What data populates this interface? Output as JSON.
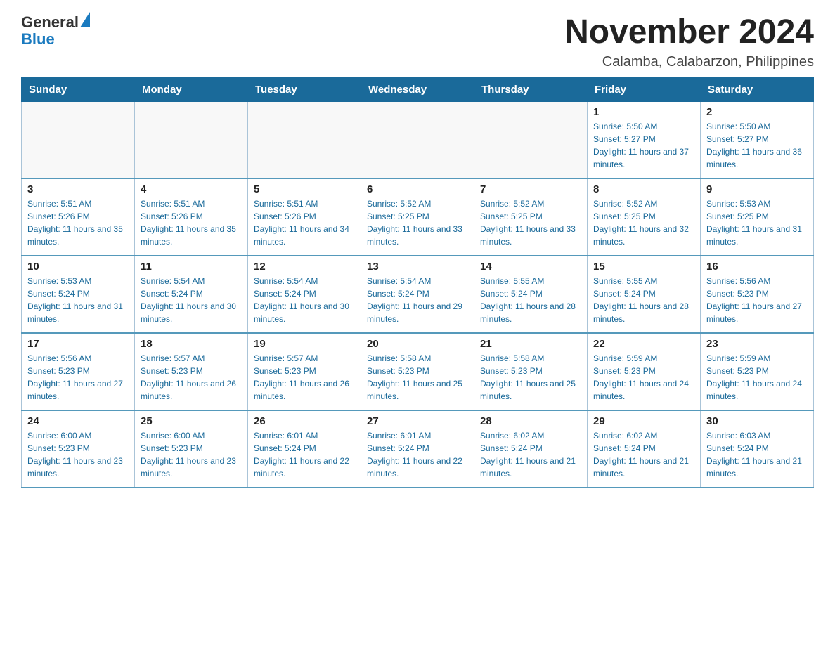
{
  "header": {
    "logo_general": "General",
    "logo_blue": "Blue",
    "month_title": "November 2024",
    "location": "Calamba, Calabarzon, Philippines"
  },
  "weekdays": [
    "Sunday",
    "Monday",
    "Tuesday",
    "Wednesday",
    "Thursday",
    "Friday",
    "Saturday"
  ],
  "weeks": [
    [
      {
        "day": "",
        "info": ""
      },
      {
        "day": "",
        "info": ""
      },
      {
        "day": "",
        "info": ""
      },
      {
        "day": "",
        "info": ""
      },
      {
        "day": "",
        "info": ""
      },
      {
        "day": "1",
        "sunrise": "Sunrise: 5:50 AM",
        "sunset": "Sunset: 5:27 PM",
        "daylight": "Daylight: 11 hours and 37 minutes."
      },
      {
        "day": "2",
        "sunrise": "Sunrise: 5:50 AM",
        "sunset": "Sunset: 5:27 PM",
        "daylight": "Daylight: 11 hours and 36 minutes."
      }
    ],
    [
      {
        "day": "3",
        "sunrise": "Sunrise: 5:51 AM",
        "sunset": "Sunset: 5:26 PM",
        "daylight": "Daylight: 11 hours and 35 minutes."
      },
      {
        "day": "4",
        "sunrise": "Sunrise: 5:51 AM",
        "sunset": "Sunset: 5:26 PM",
        "daylight": "Daylight: 11 hours and 35 minutes."
      },
      {
        "day": "5",
        "sunrise": "Sunrise: 5:51 AM",
        "sunset": "Sunset: 5:26 PM",
        "daylight": "Daylight: 11 hours and 34 minutes."
      },
      {
        "day": "6",
        "sunrise": "Sunrise: 5:52 AM",
        "sunset": "Sunset: 5:25 PM",
        "daylight": "Daylight: 11 hours and 33 minutes."
      },
      {
        "day": "7",
        "sunrise": "Sunrise: 5:52 AM",
        "sunset": "Sunset: 5:25 PM",
        "daylight": "Daylight: 11 hours and 33 minutes."
      },
      {
        "day": "8",
        "sunrise": "Sunrise: 5:52 AM",
        "sunset": "Sunset: 5:25 PM",
        "daylight": "Daylight: 11 hours and 32 minutes."
      },
      {
        "day": "9",
        "sunrise": "Sunrise: 5:53 AM",
        "sunset": "Sunset: 5:25 PM",
        "daylight": "Daylight: 11 hours and 31 minutes."
      }
    ],
    [
      {
        "day": "10",
        "sunrise": "Sunrise: 5:53 AM",
        "sunset": "Sunset: 5:24 PM",
        "daylight": "Daylight: 11 hours and 31 minutes."
      },
      {
        "day": "11",
        "sunrise": "Sunrise: 5:54 AM",
        "sunset": "Sunset: 5:24 PM",
        "daylight": "Daylight: 11 hours and 30 minutes."
      },
      {
        "day": "12",
        "sunrise": "Sunrise: 5:54 AM",
        "sunset": "Sunset: 5:24 PM",
        "daylight": "Daylight: 11 hours and 30 minutes."
      },
      {
        "day": "13",
        "sunrise": "Sunrise: 5:54 AM",
        "sunset": "Sunset: 5:24 PM",
        "daylight": "Daylight: 11 hours and 29 minutes."
      },
      {
        "day": "14",
        "sunrise": "Sunrise: 5:55 AM",
        "sunset": "Sunset: 5:24 PM",
        "daylight": "Daylight: 11 hours and 28 minutes."
      },
      {
        "day": "15",
        "sunrise": "Sunrise: 5:55 AM",
        "sunset": "Sunset: 5:24 PM",
        "daylight": "Daylight: 11 hours and 28 minutes."
      },
      {
        "day": "16",
        "sunrise": "Sunrise: 5:56 AM",
        "sunset": "Sunset: 5:23 PM",
        "daylight": "Daylight: 11 hours and 27 minutes."
      }
    ],
    [
      {
        "day": "17",
        "sunrise": "Sunrise: 5:56 AM",
        "sunset": "Sunset: 5:23 PM",
        "daylight": "Daylight: 11 hours and 27 minutes."
      },
      {
        "day": "18",
        "sunrise": "Sunrise: 5:57 AM",
        "sunset": "Sunset: 5:23 PM",
        "daylight": "Daylight: 11 hours and 26 minutes."
      },
      {
        "day": "19",
        "sunrise": "Sunrise: 5:57 AM",
        "sunset": "Sunset: 5:23 PM",
        "daylight": "Daylight: 11 hours and 26 minutes."
      },
      {
        "day": "20",
        "sunrise": "Sunrise: 5:58 AM",
        "sunset": "Sunset: 5:23 PM",
        "daylight": "Daylight: 11 hours and 25 minutes."
      },
      {
        "day": "21",
        "sunrise": "Sunrise: 5:58 AM",
        "sunset": "Sunset: 5:23 PM",
        "daylight": "Daylight: 11 hours and 25 minutes."
      },
      {
        "day": "22",
        "sunrise": "Sunrise: 5:59 AM",
        "sunset": "Sunset: 5:23 PM",
        "daylight": "Daylight: 11 hours and 24 minutes."
      },
      {
        "day": "23",
        "sunrise": "Sunrise: 5:59 AM",
        "sunset": "Sunset: 5:23 PM",
        "daylight": "Daylight: 11 hours and 24 minutes."
      }
    ],
    [
      {
        "day": "24",
        "sunrise": "Sunrise: 6:00 AM",
        "sunset": "Sunset: 5:23 PM",
        "daylight": "Daylight: 11 hours and 23 minutes."
      },
      {
        "day": "25",
        "sunrise": "Sunrise: 6:00 AM",
        "sunset": "Sunset: 5:23 PM",
        "daylight": "Daylight: 11 hours and 23 minutes."
      },
      {
        "day": "26",
        "sunrise": "Sunrise: 6:01 AM",
        "sunset": "Sunset: 5:24 PM",
        "daylight": "Daylight: 11 hours and 22 minutes."
      },
      {
        "day": "27",
        "sunrise": "Sunrise: 6:01 AM",
        "sunset": "Sunset: 5:24 PM",
        "daylight": "Daylight: 11 hours and 22 minutes."
      },
      {
        "day": "28",
        "sunrise": "Sunrise: 6:02 AM",
        "sunset": "Sunset: 5:24 PM",
        "daylight": "Daylight: 11 hours and 21 minutes."
      },
      {
        "day": "29",
        "sunrise": "Sunrise: 6:02 AM",
        "sunset": "Sunset: 5:24 PM",
        "daylight": "Daylight: 11 hours and 21 minutes."
      },
      {
        "day": "30",
        "sunrise": "Sunrise: 6:03 AM",
        "sunset": "Sunset: 5:24 PM",
        "daylight": "Daylight: 11 hours and 21 minutes."
      }
    ]
  ]
}
